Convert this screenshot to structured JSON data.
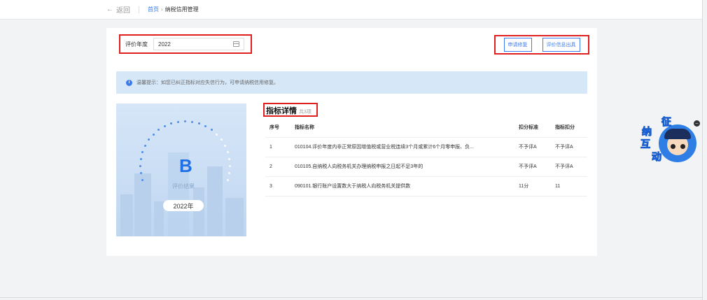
{
  "topbar": {
    "back_label": "返回",
    "breadcrumb_home": "首页",
    "breadcrumb_separator": "›",
    "breadcrumb_current": "纳税信用管理"
  },
  "filter": {
    "year_label": "评价年度",
    "year_value": "2022"
  },
  "actions": {
    "repair_label": "申请修复",
    "issue_label": "评价信息出具"
  },
  "notice": {
    "text": "温馨提示：如您已纠正指标对应失信行为，可申请纳税信用修复。"
  },
  "result": {
    "grade": "B",
    "label": "评价结果",
    "year": "2022年"
  },
  "details": {
    "title": "指标详情",
    "count": "共3项",
    "columns": [
      "序号",
      "指标名称",
      "扣分标准",
      "指标扣分"
    ],
    "rows": [
      {
        "no": "1",
        "name": "010104.评价年度内非正常原因增值税或营业税连续3个月或累计6个月零申报、负...",
        "standard": "不予评A",
        "deduction": "不予评A"
      },
      {
        "no": "2",
        "name": "010105.自纳税人向税务机关办理纳税申报之日起不足3年的",
        "standard": "不予评A",
        "deduction": "不予评A"
      },
      {
        "no": "3",
        "name": "090101.银行账户设置数大于纳税人向税务机关提供数",
        "standard": "11分",
        "deduction": "11"
      }
    ]
  },
  "widget": {
    "chars": [
      "征",
      "纳",
      "互",
      "动"
    ],
    "close_symbol": "–"
  },
  "colors": {
    "accent": "#3a7bf0",
    "highlight_border": "#e02020",
    "notice_bg": "#d6e7f8"
  }
}
